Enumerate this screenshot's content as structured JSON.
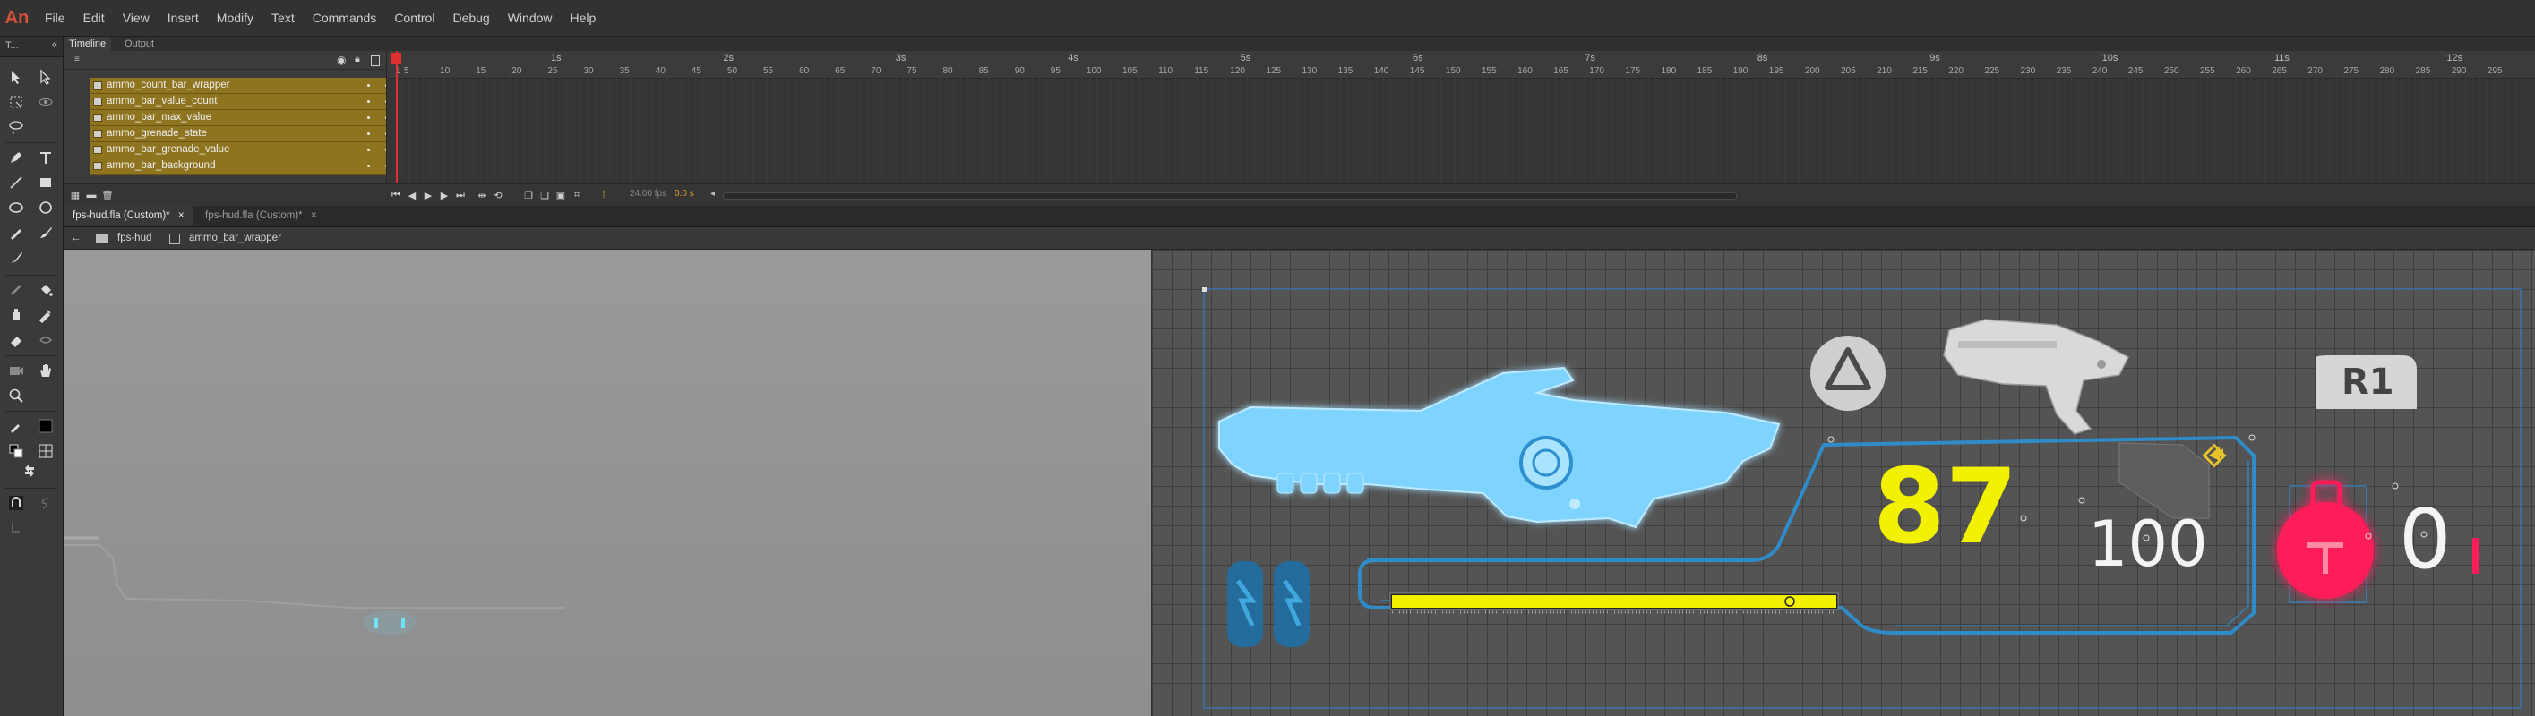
{
  "app": {
    "logo": "An"
  },
  "menu": [
    "File",
    "Edit",
    "View",
    "Insert",
    "Modify",
    "Text",
    "Commands",
    "Control",
    "Debug",
    "Window",
    "Help"
  ],
  "tools_header": "T...",
  "timeline": {
    "tabs": [
      "Timeline",
      "Output"
    ],
    "layers": [
      {
        "name": "ammo_count_bar_wrapper",
        "color": "#b23fd1"
      },
      {
        "name": "ammo_bar_value_count",
        "color": "#e5a12a"
      },
      {
        "name": "ammo_bar_max_value",
        "color": "#e23a9b"
      },
      {
        "name": "ammo_grenade_state",
        "color": "#28a84a"
      },
      {
        "name": "ammo_bar_grenade_value",
        "color": "#d83030"
      },
      {
        "name": "ammo_bar_background",
        "color": "#3b62d8"
      }
    ],
    "seconds": [
      "1s",
      "2s",
      "3s",
      "4s",
      "5s",
      "6s",
      "7s",
      "8s",
      "9s",
      "10s",
      "11s",
      "12s"
    ],
    "frames": [
      "1",
      "5",
      "10",
      "15",
      "20",
      "25",
      "30",
      "35",
      "40",
      "45",
      "50",
      "55",
      "60",
      "65",
      "70",
      "75",
      "80",
      "85",
      "90",
      "95",
      "100",
      "105",
      "110",
      "115",
      "120",
      "125",
      "130",
      "135",
      "140",
      "145",
      "150",
      "155",
      "160",
      "165",
      "170",
      "175",
      "180",
      "185",
      "190",
      "195",
      "200",
      "205",
      "210",
      "215",
      "220",
      "225",
      "230",
      "235",
      "240",
      "245",
      "250",
      "255",
      "260",
      "265",
      "270",
      "275",
      "280",
      "285",
      "290",
      "295"
    ],
    "fps": "24.00 fps",
    "current_frame": "0.0 s"
  },
  "doc_tabs": [
    {
      "label": "fps-hud.fla (Custom)*",
      "active": true
    },
    {
      "label": "fps-hud.fla (Custom)*",
      "active": false
    }
  ],
  "breadcrumb": {
    "scene": "fps-hud",
    "symbol": "ammo_bar_wrapper"
  },
  "hud": {
    "ammo_count": "87",
    "ammo_max": "100",
    "grenade_count": "0",
    "triangle_button": "△",
    "r1_button": "R1",
    "ammo_fill": 1.0,
    "colors": {
      "ammo": "#f2f200",
      "accent": "#3aa6e6",
      "grenade": "#ff1e5a"
    }
  },
  "icons": {
    "close": "×",
    "back": "←"
  }
}
